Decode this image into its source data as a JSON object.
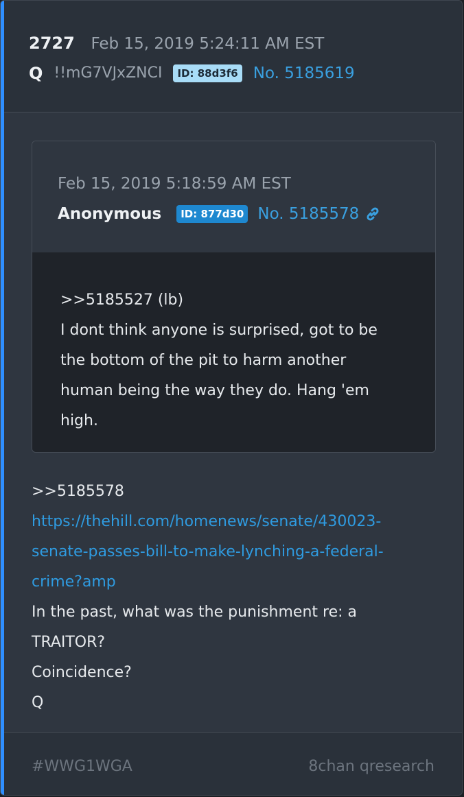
{
  "post": {
    "number": "2727",
    "date": "Feb 15, 2019 5:24:11 AM EST",
    "author": "Q",
    "tripcode": "!!mG7VJxZNCI",
    "id_badge": "ID: 88d3f6",
    "post_no": "No. 5185619"
  },
  "quoted": {
    "date": "Feb 15, 2019 5:18:59 AM EST",
    "author": "Anonymous",
    "id_badge": "ID: 877d30",
    "post_no": "No. 5185578",
    "link_icon": "link-icon",
    "lines": [
      ">>5185527 (lb)",
      "I dont think anyone is surprised, got to be",
      "the bottom of the pit to harm another",
      "human being the way they do. Hang 'em",
      "high."
    ]
  },
  "body": {
    "reply_ref": ">>5185578",
    "url_lines": [
      "https://thehill.com/homenews/senate/430023-",
      "senate-passes-bill-to-make-lynching-a-federal-",
      "crime?amp"
    ],
    "text_lines": [
      "In the past, what was the punishment re: a",
      "TRAITOR?",
      "Coincidence?",
      "Q"
    ]
  },
  "footer": {
    "tag": "#WWG1WGA",
    "source": "8chan qresearch"
  },
  "colors": {
    "accent": "#2f8fff",
    "link": "#2f9be0",
    "id_badge_q": "#a8dcf7",
    "id_badge_anon": "#1e88d0"
  }
}
